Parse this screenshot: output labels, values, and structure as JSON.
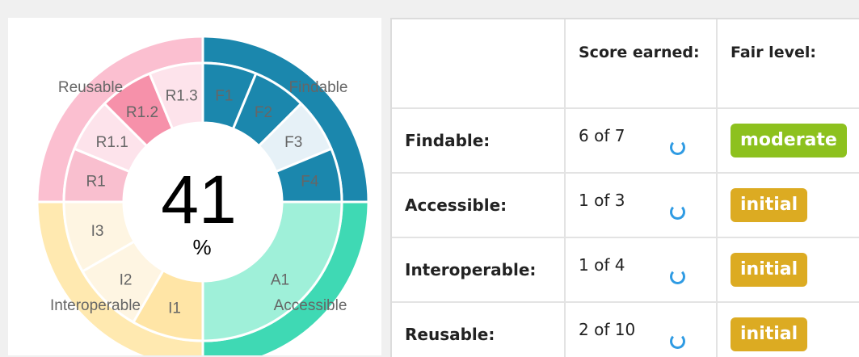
{
  "chart_data": {
    "type": "pie",
    "center_value": "41",
    "center_unit": "%",
    "outer_ring": [
      {
        "label": "Findable",
        "color": "#1b87ad"
      },
      {
        "label": "Accessible",
        "color": "#3fd9b4"
      },
      {
        "label": "Interoperable",
        "color": "#ffe9b0"
      },
      {
        "label": "Reusable",
        "color": "#fbbfd0"
      }
    ],
    "inner_ring": [
      {
        "label": "F1",
        "group": "Findable",
        "color": "#1b87ad"
      },
      {
        "label": "F2",
        "group": "Findable",
        "color": "#1b87ad"
      },
      {
        "label": "F3",
        "group": "Findable",
        "color": "#e6f1f7"
      },
      {
        "label": "F4",
        "group": "Findable",
        "color": "#1b87ad"
      },
      {
        "label": "A1",
        "group": "Accessible",
        "color": "#9ff0d9"
      },
      {
        "label": "I1",
        "group": "Interoperable",
        "color": "#ffe5a6"
      },
      {
        "label": "I2",
        "group": "Interoperable",
        "color": "#fef5e2"
      },
      {
        "label": "I3",
        "group": "Interoperable",
        "color": "#fef5e2"
      },
      {
        "label": "R1",
        "group": "Reusable",
        "color": "#f9bfcf"
      },
      {
        "label": "R1.1",
        "group": "Reusable",
        "color": "#fde3eb"
      },
      {
        "label": "R1.2",
        "group": "Reusable",
        "color": "#f691aa"
      },
      {
        "label": "R1.3",
        "group": "Reusable",
        "color": "#fde3eb"
      }
    ]
  },
  "table": {
    "headers": [
      "",
      "Score earned:",
      "Fair level:"
    ],
    "rows": [
      {
        "name": "Findable:",
        "score": "6 of 7",
        "level": "moderate"
      },
      {
        "name": "Accessible:",
        "score": "1 of 3",
        "level": "initial"
      },
      {
        "name": "Interoperable:",
        "score": "1 of 4",
        "level": "initial"
      },
      {
        "name": "Reusable:",
        "score": "2 of 10",
        "level": "initial"
      }
    ]
  },
  "colors": {
    "moderate": "#8dc11e",
    "initial": "#dcab22",
    "spinner": "#2f9be3"
  },
  "icons": {
    "spinner": "loading-spinner-icon"
  }
}
